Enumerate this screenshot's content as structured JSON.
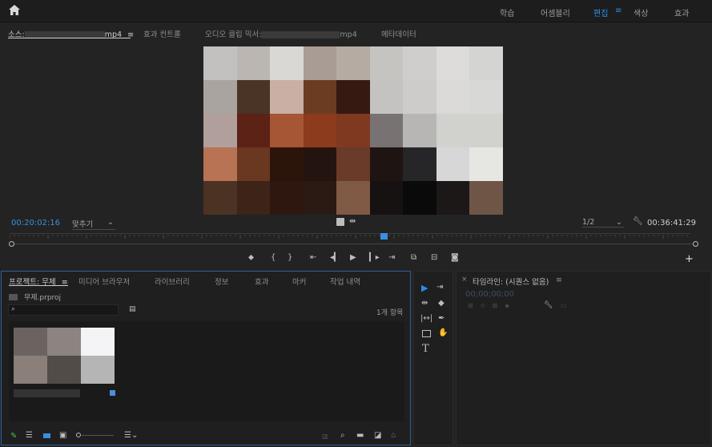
{
  "topbar": {
    "home_icon": "home-icon",
    "workspaces": [
      "학습",
      "어셈블리",
      "편집",
      "색상",
      "효과"
    ],
    "active_workspace": "편집",
    "menu_icon": "≡"
  },
  "source_panel": {
    "tabs": {
      "source_prefix": "소스:",
      "source_suffix": "mp4",
      "effects_controls": "효과 컨트롤",
      "audio_mixer_prefix": "오디오 클립 믹서:",
      "audio_mixer_suffix": "mp4",
      "metadata": "메타데이터"
    },
    "menu_icon": "≡",
    "timecode_in": "00:20:02:16",
    "fit_label": "맞추기",
    "resolution": "1/2",
    "duration": "00:36:41:29",
    "video_colors": [
      [
        "#c3c1bf",
        "#bbb6b2",
        "#dad8d4",
        "#a99c94",
        "#b5aba3",
        "#c6c4c1",
        "#cfcecc",
        "#dddcda",
        "#d4d4d2"
      ],
      [
        "#aaa4a0",
        "#4a3426",
        "#c8b0a4",
        "#6b3c22",
        "#361a12",
        "#c4c3c1",
        "#cdcccb",
        "#dbdad8",
        "#d8d8d6"
      ],
      [
        "#b09f9a",
        "#5c2215",
        "#a65535",
        "#8c3b1c",
        "#7e3920",
        "#787372",
        "#b7b6b4",
        "#d1d1ce",
        "#d1d2ce"
      ],
      [
        "#b87355",
        "#6a3720",
        "#2b1409",
        "#241410",
        "#693b28",
        "#1e1513",
        "#262629",
        "#d7d7d7",
        "#e6e7e2"
      ],
      [
        "#4c3222",
        "#3d2318",
        "#2e170e",
        "#2b1a14",
        "#805a45",
        "#161212",
        "#0b0a0b",
        "#1c1817",
        "#6e5546"
      ]
    ]
  },
  "project_panel": {
    "tabs": [
      "프로젝트: 무제",
      "미디어 브라우저",
      "라이브러리",
      "정보",
      "효과",
      "마커",
      "작업 내역"
    ],
    "menu_icon": "≡",
    "file_name": "무제.prproj",
    "item_count": "1개 항목",
    "thumb_colors": [
      "#6b6360",
      "#8c8480",
      "#f4f4f6",
      "#8a7f79",
      "#524c49",
      "#b5b5b6"
    ]
  },
  "timeline_panel": {
    "title": "타임라인: (시퀀스 없음)",
    "menu_icon": "≡",
    "timecode": "00;00;00;00"
  },
  "colors": {
    "accent": "#2d8ceb",
    "timecode_blue": "#3a8fe0",
    "panel_focus_border": "#2d5f9a"
  }
}
